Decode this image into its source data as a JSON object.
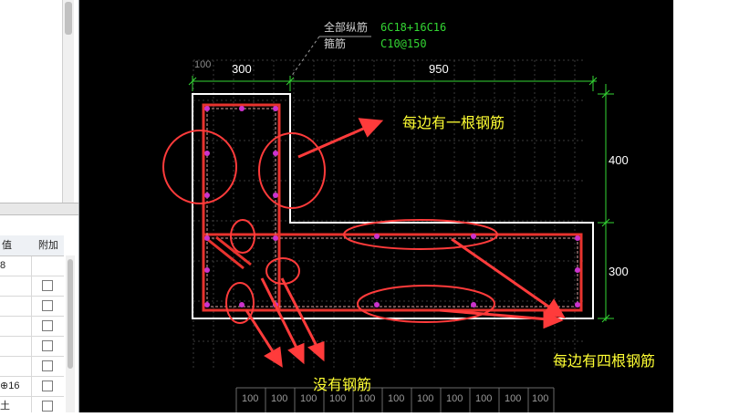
{
  "left_panel": {
    "table": {
      "header_value": "值",
      "header_extra": "附加",
      "rows": [
        {
          "value": "8",
          "checked": false,
          "has_checkbox": false
        },
        {
          "value": "",
          "checked": false,
          "has_checkbox": true
        },
        {
          "value": "",
          "checked": false,
          "has_checkbox": true
        },
        {
          "value": "",
          "checked": false,
          "has_checkbox": true
        },
        {
          "value": "",
          "checked": false,
          "has_checkbox": true
        },
        {
          "value": "",
          "checked": false,
          "has_checkbox": true
        },
        {
          "value": "⊕16",
          "checked": false,
          "has_checkbox": true
        },
        {
          "value": "土",
          "checked": false,
          "has_checkbox": true
        }
      ]
    }
  },
  "drawing": {
    "label_longitudinal": "全部纵筋",
    "value_longitudinal": "6C18+16C16",
    "label_stirrup": "箍筋",
    "value_stirrup": "C10@150",
    "dim_top_left": "300",
    "dim_top_right": "950",
    "dim_right_upper": "400",
    "dim_right_lower": "300",
    "grid_left_label": "100",
    "grid_bottom_labels": [
      "100",
      "100",
      "100",
      "100",
      "100",
      "100",
      "100",
      "100",
      "100",
      "100",
      "100"
    ],
    "annotation_each_side_one": "每边有一根钢筋",
    "annotation_no_rebar": "没有钢筋",
    "annotation_each_side_four": "每边有四根钢筋"
  },
  "colors": {
    "canvas_bg": "#000000",
    "outline": "#ffffff",
    "rebar": "#e8332e",
    "dimension": "#33d633",
    "annotation_text": "#ffff33",
    "markup": "#ff3b3b",
    "rebar_dot": "#cc33cc",
    "label_grey": "#bdbdbd",
    "label_green": "#33d633"
  }
}
